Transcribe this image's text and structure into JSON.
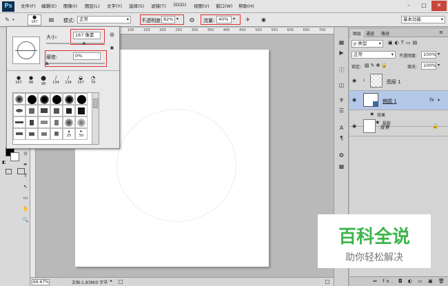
{
  "app": {
    "logo": "Ps"
  },
  "menu": [
    "文件(F)",
    "编辑(E)",
    "图像(I)",
    "图层(L)",
    "文字(Y)",
    "选择(S)",
    "滤镜(T)",
    "3D(D)",
    "视图(V)",
    "窗口(W)",
    "帮助(H)"
  ],
  "window": {
    "minimize": "–",
    "maximize": "□",
    "close": "✕"
  },
  "options": {
    "brush_size": "167",
    "mode_label": "模式:",
    "mode_value": "正常",
    "opacity_label": "不透明度:",
    "opacity_value": "82%",
    "flow_label": "流量:",
    "flow_value": "40%",
    "workspace": "基本功能"
  },
  "brush_popup": {
    "size_label": "大小:",
    "size_value": "167 像素",
    "hardness_label": "硬度:",
    "hardness_value": "0%",
    "presets_row1": [
      "167",
      "88",
      "98",
      "134",
      "134",
      "157",
      "79"
    ],
    "presets_labels_bottom": [
      "25",
      "50"
    ]
  },
  "ruler": {
    "ticks": [
      "200",
      "150",
      "100",
      "50",
      "0",
      "50",
      "100",
      "150",
      "200",
      "250",
      "300",
      "350",
      "400",
      "450",
      "500",
      "550",
      "600",
      "650",
      "700"
    ]
  },
  "status": {
    "zoom": "66.67%",
    "doc": "文档:1.83M/0 字节"
  },
  "layers": {
    "tabs": [
      "图层",
      "通道",
      "路径"
    ],
    "filter_label": "ρ 类型",
    "blend_mode": "正常",
    "opacity_label": "不透明度:",
    "opacity_value": "100%",
    "lock_label": "锁定:",
    "fill_label": "填充:",
    "fill_value": "100%",
    "items": [
      {
        "name": "图层 1"
      },
      {
        "name": "椭圆 1",
        "fx": "fx"
      },
      {
        "name": "背景"
      }
    ],
    "effects_label": "效果",
    "shadow_label": "投影",
    "bottom_icons": "⇔ fx. ◘ ◐ ▭ ▣ 🗑"
  },
  "watermark": {
    "title": "百科全说",
    "subtitle": "助你轻松解决"
  },
  "colors": {
    "watermark_green": "#3db54a",
    "highlight": "#b4c8e8",
    "red_outline": "#e03030"
  }
}
